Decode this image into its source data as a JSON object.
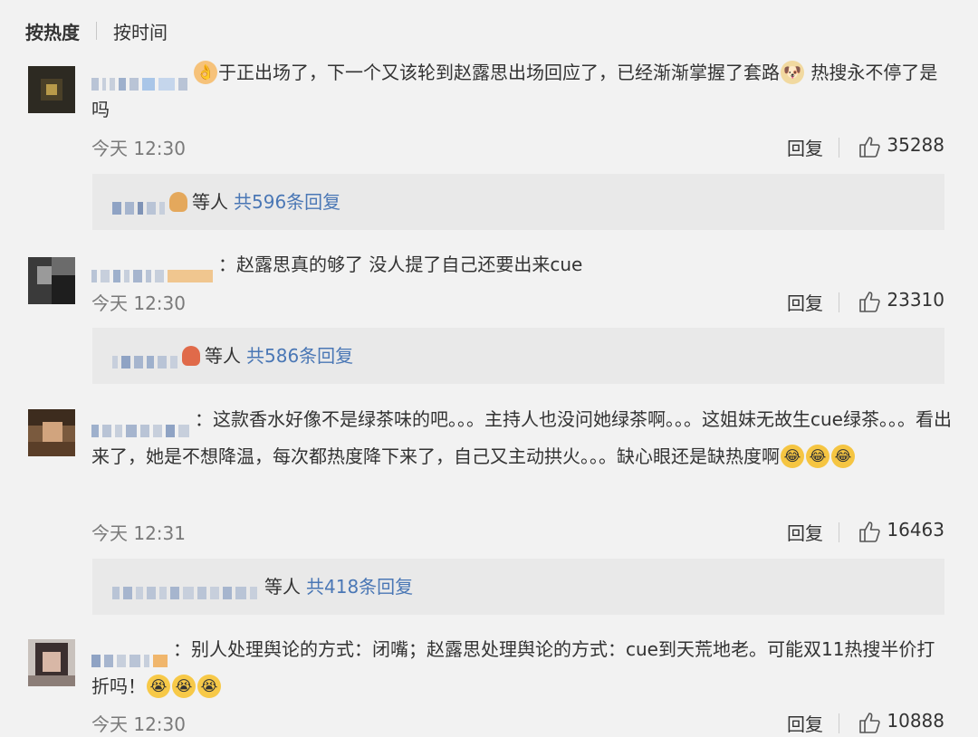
{
  "sort": {
    "hot_label": "按热度",
    "time_label": "按时间"
  },
  "colors": {
    "link_blue": "#4a77b5",
    "meta_gray": "#7a7a7a",
    "reply_bg": "#e9e9e9"
  },
  "comments": [
    {
      "text_a": "于正出场了，下一个又该轮到赵露思出场回应了，已经渐渐掌握了套路",
      "text_b": " 热搜永不停了是吗",
      "time": "今天 12:30",
      "reply_label": "回复",
      "likes": "35288",
      "reply_summary": {
        "who": "等人",
        "total": "共596条回复"
      }
    },
    {
      "text_a": "：赵露思真的够了 没人提了自己还要出来cue",
      "time": "今天 12:30",
      "reply_label": "回复",
      "likes": "23310",
      "reply_summary": {
        "who": "等人",
        "total": "共586条回复"
      }
    },
    {
      "text_a": "：这款香水好像不是绿茶味的吧。。。主持人也没问她绿茶啊。。。这姐妹无故生cue绿茶。。。看出来了，她是不想降温，每次都热度降下来了，自己又主动拱火。。。缺心眼还是缺热度啊",
      "time": "今天 12:31",
      "reply_label": "回复",
      "likes": "16463",
      "reply_summary": {
        "who": "等人",
        "total": "共418条回复"
      }
    },
    {
      "text_a": "：别人处理舆论的方式：闭嘴；赵露思处理舆论的方式：cue到天荒地老。可能双11热搜半价打折吗！",
      "time": "今天 12:30",
      "reply_label": "回复",
      "likes": "10888"
    }
  ],
  "icons": {
    "like": "thumbs-up-icon",
    "emoji_ok": "ok-hand-emoji",
    "emoji_doge": "doge-emoji",
    "emoji_laugh_cry": "laugh-cry-emoji",
    "emoji_tears": "tears-emoji"
  }
}
